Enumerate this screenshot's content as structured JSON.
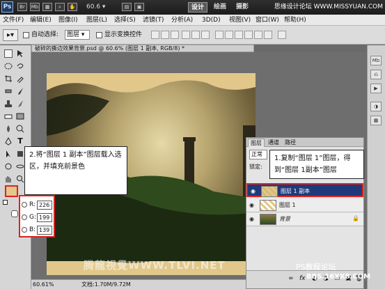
{
  "app": {
    "logo": "Ps",
    "zoom": "60.6",
    "workspaces": [
      "设计",
      "绘画",
      "摄影"
    ],
    "watermark_top": "思缘设计论坛 WWW.MISSYUAN.COM"
  },
  "menu": [
    "文件(F)",
    "编辑(E)",
    "图像(I)",
    "图层(L)",
    "选择(S)",
    "滤镜(T)",
    "分析(A)",
    "3D(D)",
    "视图(V)",
    "窗口(W)",
    "帮助(H)"
  ],
  "options": {
    "auto_select_label": "自动选择:",
    "auto_select_value": "图层",
    "show_transform_label": "显示变换控件"
  },
  "document": {
    "tab_title": "破碎的撕边效果背景.psd @ 60.6% (图层 1 副本, RGB/8) *",
    "zoom_status": "60.61%",
    "doc_size": "文档:1.70M/9.72M"
  },
  "layers_panel": {
    "tabs": [
      "图层",
      "通道",
      "路径"
    ],
    "blend_mode": "正常",
    "lock_label": "锁定:",
    "layers": [
      {
        "name": "图层 1 副本",
        "selected": true
      },
      {
        "name": "图层 1",
        "selected": false
      },
      {
        "name": "背景",
        "selected": false
      }
    ]
  },
  "callouts": {
    "left": "2.将“图层 1 副本”图层载入选区，并填充前景色",
    "right": "1.复制“图层 1”图层，得到“图层 1副本”图层"
  },
  "color": {
    "foreground_hex": "#e2c78b",
    "rows": [
      {
        "label": "R:",
        "value": "226"
      },
      {
        "label": "G:",
        "value": "199"
      },
      {
        "label": "B:",
        "value": "139"
      }
    ]
  },
  "watermarks": {
    "bottom_center": "腾龍視覺WWW.TLVI.NET",
    "bottom_right": "PS教程论坛",
    "bottom_right_url": "BBS.16XX8.COM"
  }
}
